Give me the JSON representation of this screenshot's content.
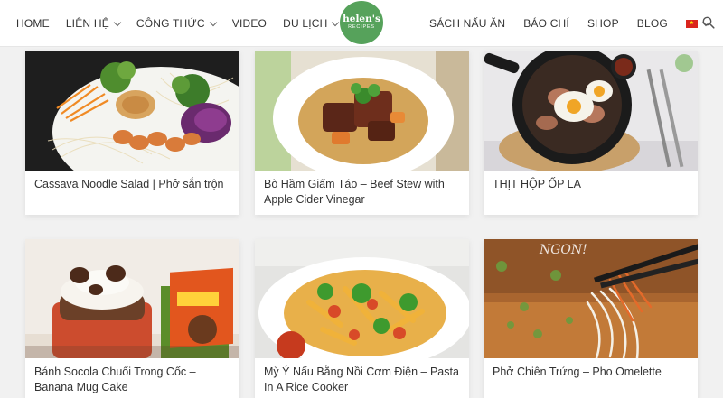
{
  "header": {
    "nav_left": [
      {
        "label": "HOME",
        "dropdown": false
      },
      {
        "label": "LIÊN HỆ",
        "dropdown": true
      },
      {
        "label": "CÔNG THỨC",
        "dropdown": true
      },
      {
        "label": "VIDEO",
        "dropdown": false
      },
      {
        "label": "DU LỊCH",
        "dropdown": true
      }
    ],
    "logo": {
      "line1": "helen's",
      "line2": "RECIPES",
      "color": "#56a25b"
    },
    "nav_right": [
      {
        "label": "SÁCH NẤU ĂN"
      },
      {
        "label": "BÁO CHÍ"
      },
      {
        "label": "SHOP"
      },
      {
        "label": "BLOG"
      }
    ],
    "language": {
      "icon": "vietnam-flag-icon"
    },
    "search_icon": "search-icon"
  },
  "recipes": [
    {
      "title": "Cassava Noodle Salad | Phở sắn trộn"
    },
    {
      "title": "Bò Hầm Giấm Táo – Beef Stew with Apple Cider Vinegar"
    },
    {
      "title": "THỊT HỘP ỐP LA"
    },
    {
      "title": "Bánh Socola Chuối Trong Cốc – Banana Mug Cake"
    },
    {
      "title": "Mỳ Ý Nấu Bằng Nồi Cơm Điện – Pasta In A Rice Cooker"
    },
    {
      "title": "Phở Chiên Trứng – Pho Omelette"
    }
  ],
  "image_text": {
    "ngon": "NGON!"
  }
}
